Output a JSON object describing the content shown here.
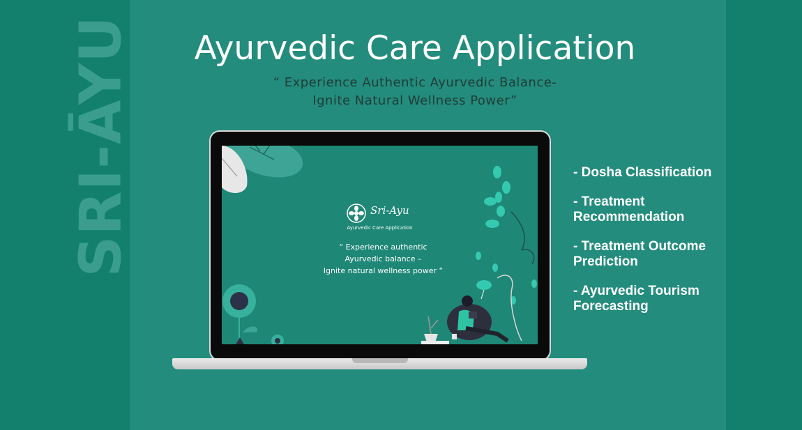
{
  "brand_vertical": "SRI-ĀYU",
  "title": "Ayurvedic Care Application",
  "tagline": {
    "line1": "“ Experience Authentic Ayurvedic Balance-",
    "line2": "Ignite Natural Wellness Power”"
  },
  "screen": {
    "brand": "Sri-Ayu",
    "subtitle": "Ayurvedic Care Application",
    "quote_line1": "“ Experience authentic",
    "quote_line2": "Ayurvedic balance –",
    "quote_line3": "Ignite natural wellness power “"
  },
  "features": [
    {
      "label": "- Dosha Classification"
    },
    {
      "label": "- Treatment Recommendation"
    },
    {
      "label": "- Treatment Outcome Prediction"
    },
    {
      "label": "- Ayurvedic Tourism Forecasting"
    }
  ],
  "colors": {
    "background": "#238c7d",
    "side_panels": "#13806e",
    "screen": "#1e8776",
    "accent_leaf": "#35c9b0"
  }
}
